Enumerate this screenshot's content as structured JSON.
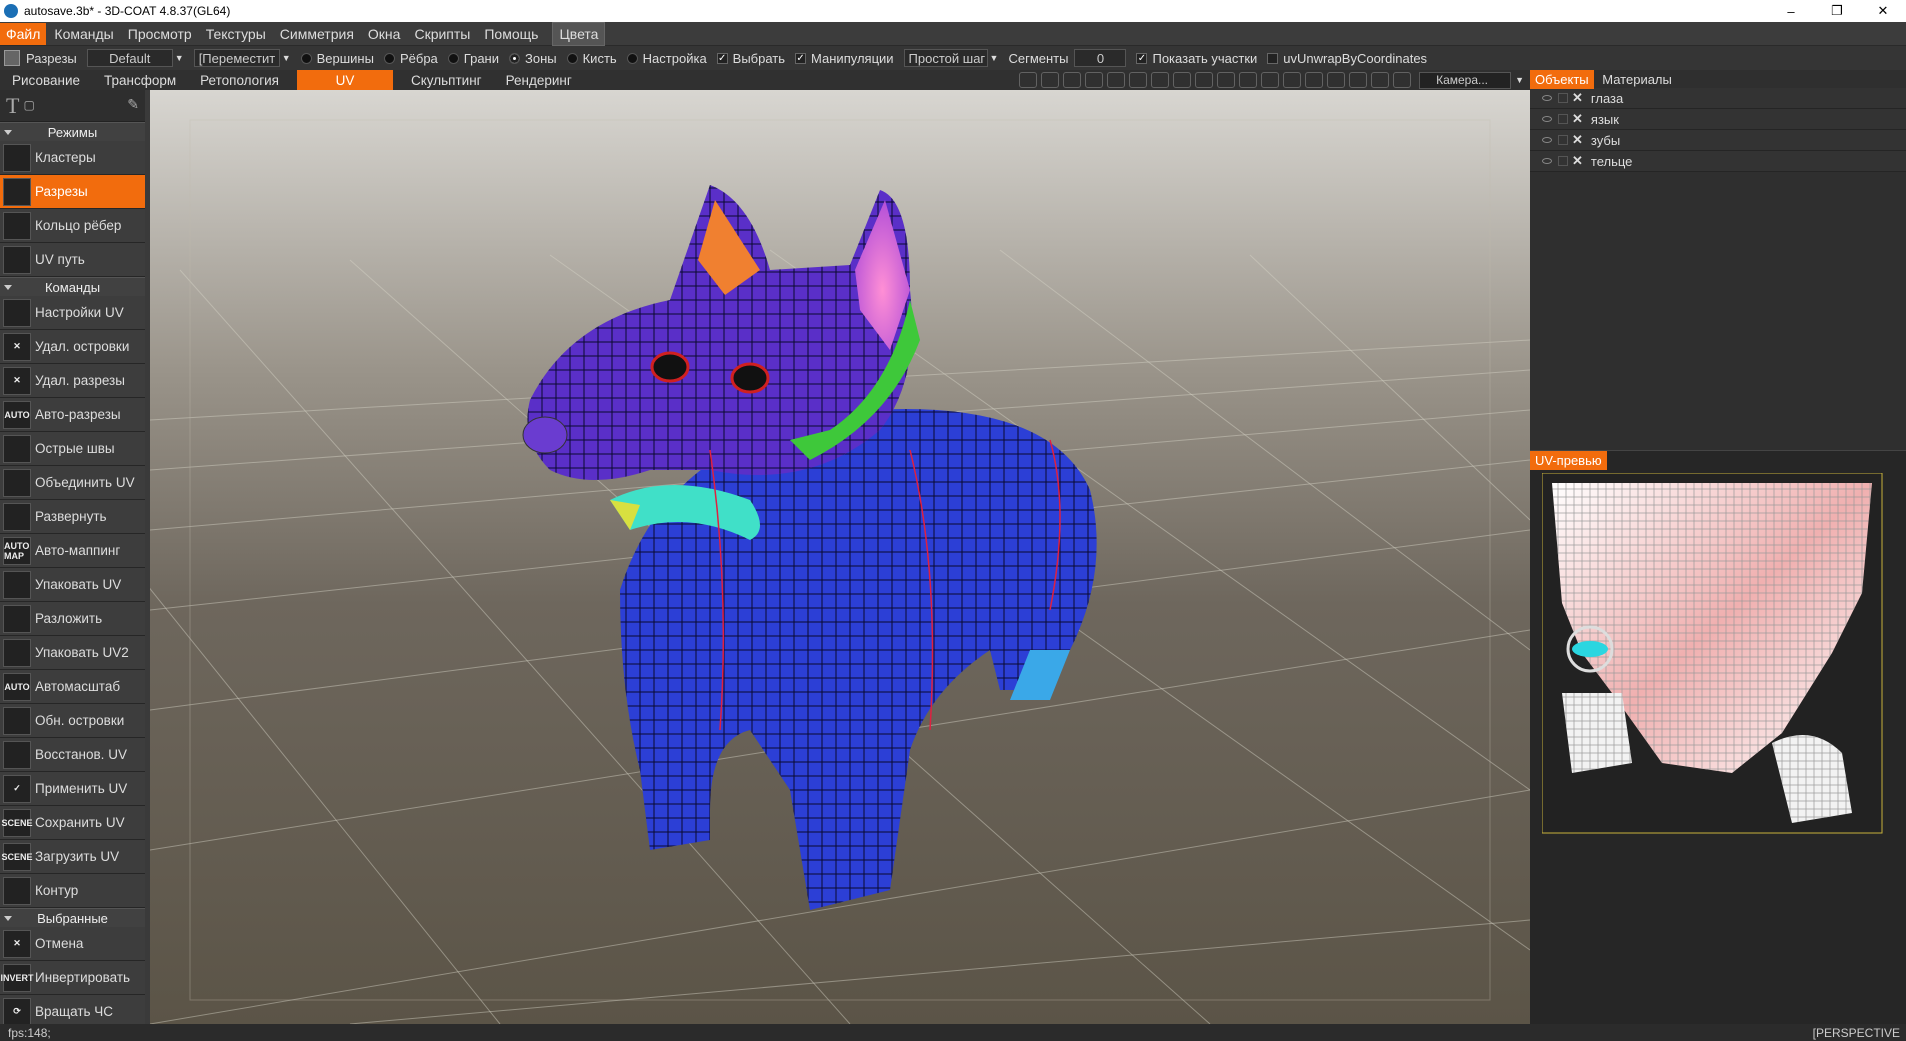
{
  "window": {
    "title": "autosave.3b* - 3D-COAT 4.8.37(GL64)",
    "minimize": "–",
    "restore": "❐",
    "close": "✕"
  },
  "menu": {
    "items": [
      "Файл",
      "Команды",
      "Просмотр",
      "Текстуры",
      "Симметрия",
      "Окна",
      "Скрипты",
      "Помощь"
    ],
    "colors": "Цвета"
  },
  "toolbar": {
    "tool": "Разрезы",
    "preset": "Default",
    "move": "[Переместит",
    "vertices": "Вершины",
    "edges": "Рёбра",
    "faces": "Грани",
    "zones": "Зоны",
    "brush": "Кисть",
    "settings": "Настройка",
    "select": "Выбрать",
    "manipulators": "Манипуляции",
    "step": "Простой шаг",
    "segments": "Сегменты",
    "segments_value": "0",
    "show_islands": "Показать участки",
    "uv_unwrap": "uvUnwrapByCoordinates"
  },
  "rooms": {
    "items": [
      "Рисование",
      "Трансформ",
      "Ретопология",
      "UV",
      "Скульптинг",
      "Рендеринг"
    ],
    "active": "UV",
    "camera": "Камера..."
  },
  "left": {
    "modes_header": "Режимы",
    "modes": [
      {
        "label": "Кластеры"
      },
      {
        "label": "Разрезы",
        "active": true
      },
      {
        "label": "Кольцо рёбер"
      },
      {
        "label": "UV путь"
      }
    ],
    "commands_header": "Команды",
    "commands": [
      {
        "label": "Настройки UV"
      },
      {
        "label": "Удал. островки",
        "icon": "✕"
      },
      {
        "label": "Удал. разрезы",
        "icon": "✕"
      },
      {
        "label": "Авто-разрезы",
        "icon": "AUTO"
      },
      {
        "label": "Острые швы"
      },
      {
        "label": "Объединить UV"
      },
      {
        "label": "Развернуть"
      },
      {
        "label": "Авто-маппинг",
        "icon": "AUTO MAP"
      },
      {
        "label": "Упаковать UV"
      },
      {
        "label": "Разложить"
      },
      {
        "label": "Упаковать UV2"
      },
      {
        "label": "Автомасштаб",
        "icon": "AUTO"
      },
      {
        "label": "Обн. островки"
      },
      {
        "label": "Восстанов. UV"
      },
      {
        "label": "Применить UV",
        "icon": "✓"
      },
      {
        "label": "Сохранить UV",
        "icon": "SCENE"
      },
      {
        "label": "Загрузить UV",
        "icon": "SCENE"
      },
      {
        "label": "Контур"
      }
    ],
    "selected_header": "Выбранные",
    "selected": [
      {
        "label": "Отмена",
        "icon": "✕"
      },
      {
        "label": "Инвертировать",
        "icon": "INVERT"
      },
      {
        "label": "Вращать ЧС",
        "icon": "⟳"
      }
    ]
  },
  "right": {
    "tabs": [
      "Объекты",
      "Материалы"
    ],
    "objects": [
      "глаза",
      "язык",
      "зубы",
      "тельце"
    ],
    "uv_preview": "UV-превью"
  },
  "status": {
    "fps": "fps:148;",
    "view": "[PERSPECTIVE"
  },
  "colors": {
    "accent": "#f26c0d",
    "mesh_body": "#2c3fd6",
    "mesh_head": "#5a2fc8"
  }
}
